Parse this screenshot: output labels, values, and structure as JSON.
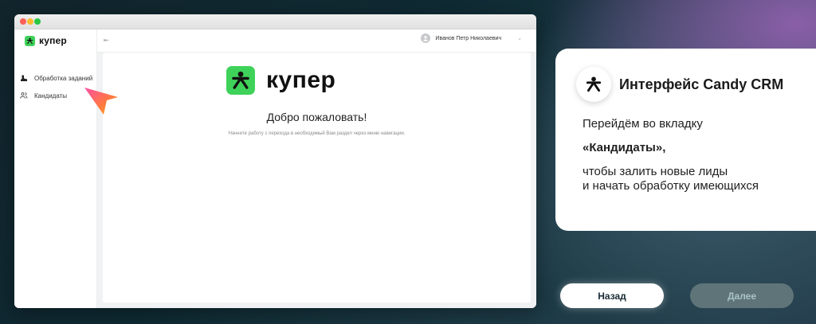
{
  "app": {
    "logo_text": "купер",
    "brand_text": "купер",
    "sidebar": {
      "items": [
        {
          "label": "Обработка заданий",
          "icon": "boot-icon"
        },
        {
          "label": "Кандидаты",
          "icon": "users-icon"
        }
      ]
    },
    "header": {
      "user_name": "Иванов Петр Николаевич"
    },
    "main": {
      "welcome": "Добро пожаловать!",
      "hint": "Начните работу с перехода в необходимый Вам раздел через меню навигации."
    }
  },
  "card": {
    "title": "Интерфейс Candy CRM",
    "line1": "Перейдём во вкладку",
    "line2": "«Кандидаты»,",
    "line3a": "чтобы залить новые лиды",
    "line3b": "и начать обработку имеющихся"
  },
  "buttons": {
    "back": "Назад",
    "next": "Далее"
  },
  "colors": {
    "brand_green": "#3fd25a",
    "next_button_bg": "#5f7479",
    "back_button_text": "#1a2c35"
  }
}
